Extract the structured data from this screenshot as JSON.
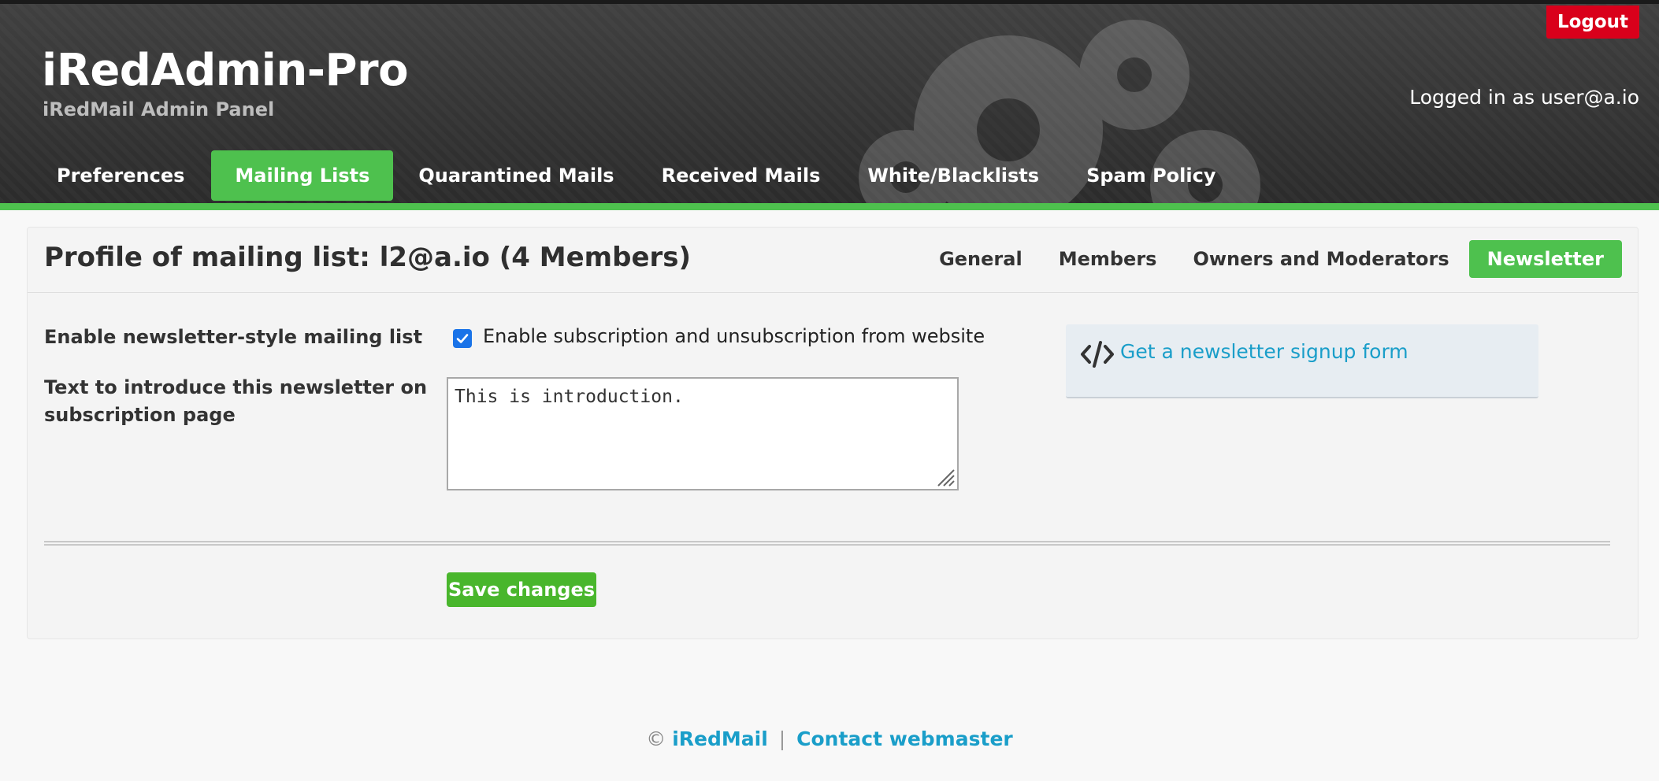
{
  "header": {
    "title": "iRedAdmin-Pro",
    "subtitle": "iRedMail Admin Panel",
    "logout_label": "Logout",
    "logged_in_text": "Logged in as user@a.io"
  },
  "nav": {
    "items": [
      {
        "label": "Preferences",
        "active": false
      },
      {
        "label": "Mailing Lists",
        "active": true
      },
      {
        "label": "Quarantined Mails",
        "active": false
      },
      {
        "label": "Received Mails",
        "active": false
      },
      {
        "label": "White/Blacklists",
        "active": false
      },
      {
        "label": "Spam Policy",
        "active": false
      }
    ]
  },
  "profile": {
    "title": "Profile of mailing list: l2@a.io (4 Members)",
    "tabs": [
      {
        "label": "General",
        "active": false
      },
      {
        "label": "Members",
        "active": false
      },
      {
        "label": "Owners and Moderators",
        "active": false
      },
      {
        "label": "Newsletter",
        "active": true
      }
    ]
  },
  "form": {
    "enable_label": "Enable newsletter-style mailing list",
    "enable_checkbox_label": "Enable subscription and unsubscription from website",
    "enable_checked": true,
    "intro_label_line1": "Text to introduce this newsletter on",
    "intro_label_line2": "subscription page",
    "intro_value": "This is introduction.",
    "signup_link": "Get a newsletter signup form",
    "save_label": "Save changes"
  },
  "footer": {
    "copyright": "©",
    "link1": "iRedMail",
    "separator": "|",
    "link2": "Contact webmaster"
  },
  "colors": {
    "accent_green": "#4ec14e",
    "logout_red": "#d9001b",
    "link_blue": "#1a9ec9",
    "save_green": "#49b62c"
  }
}
